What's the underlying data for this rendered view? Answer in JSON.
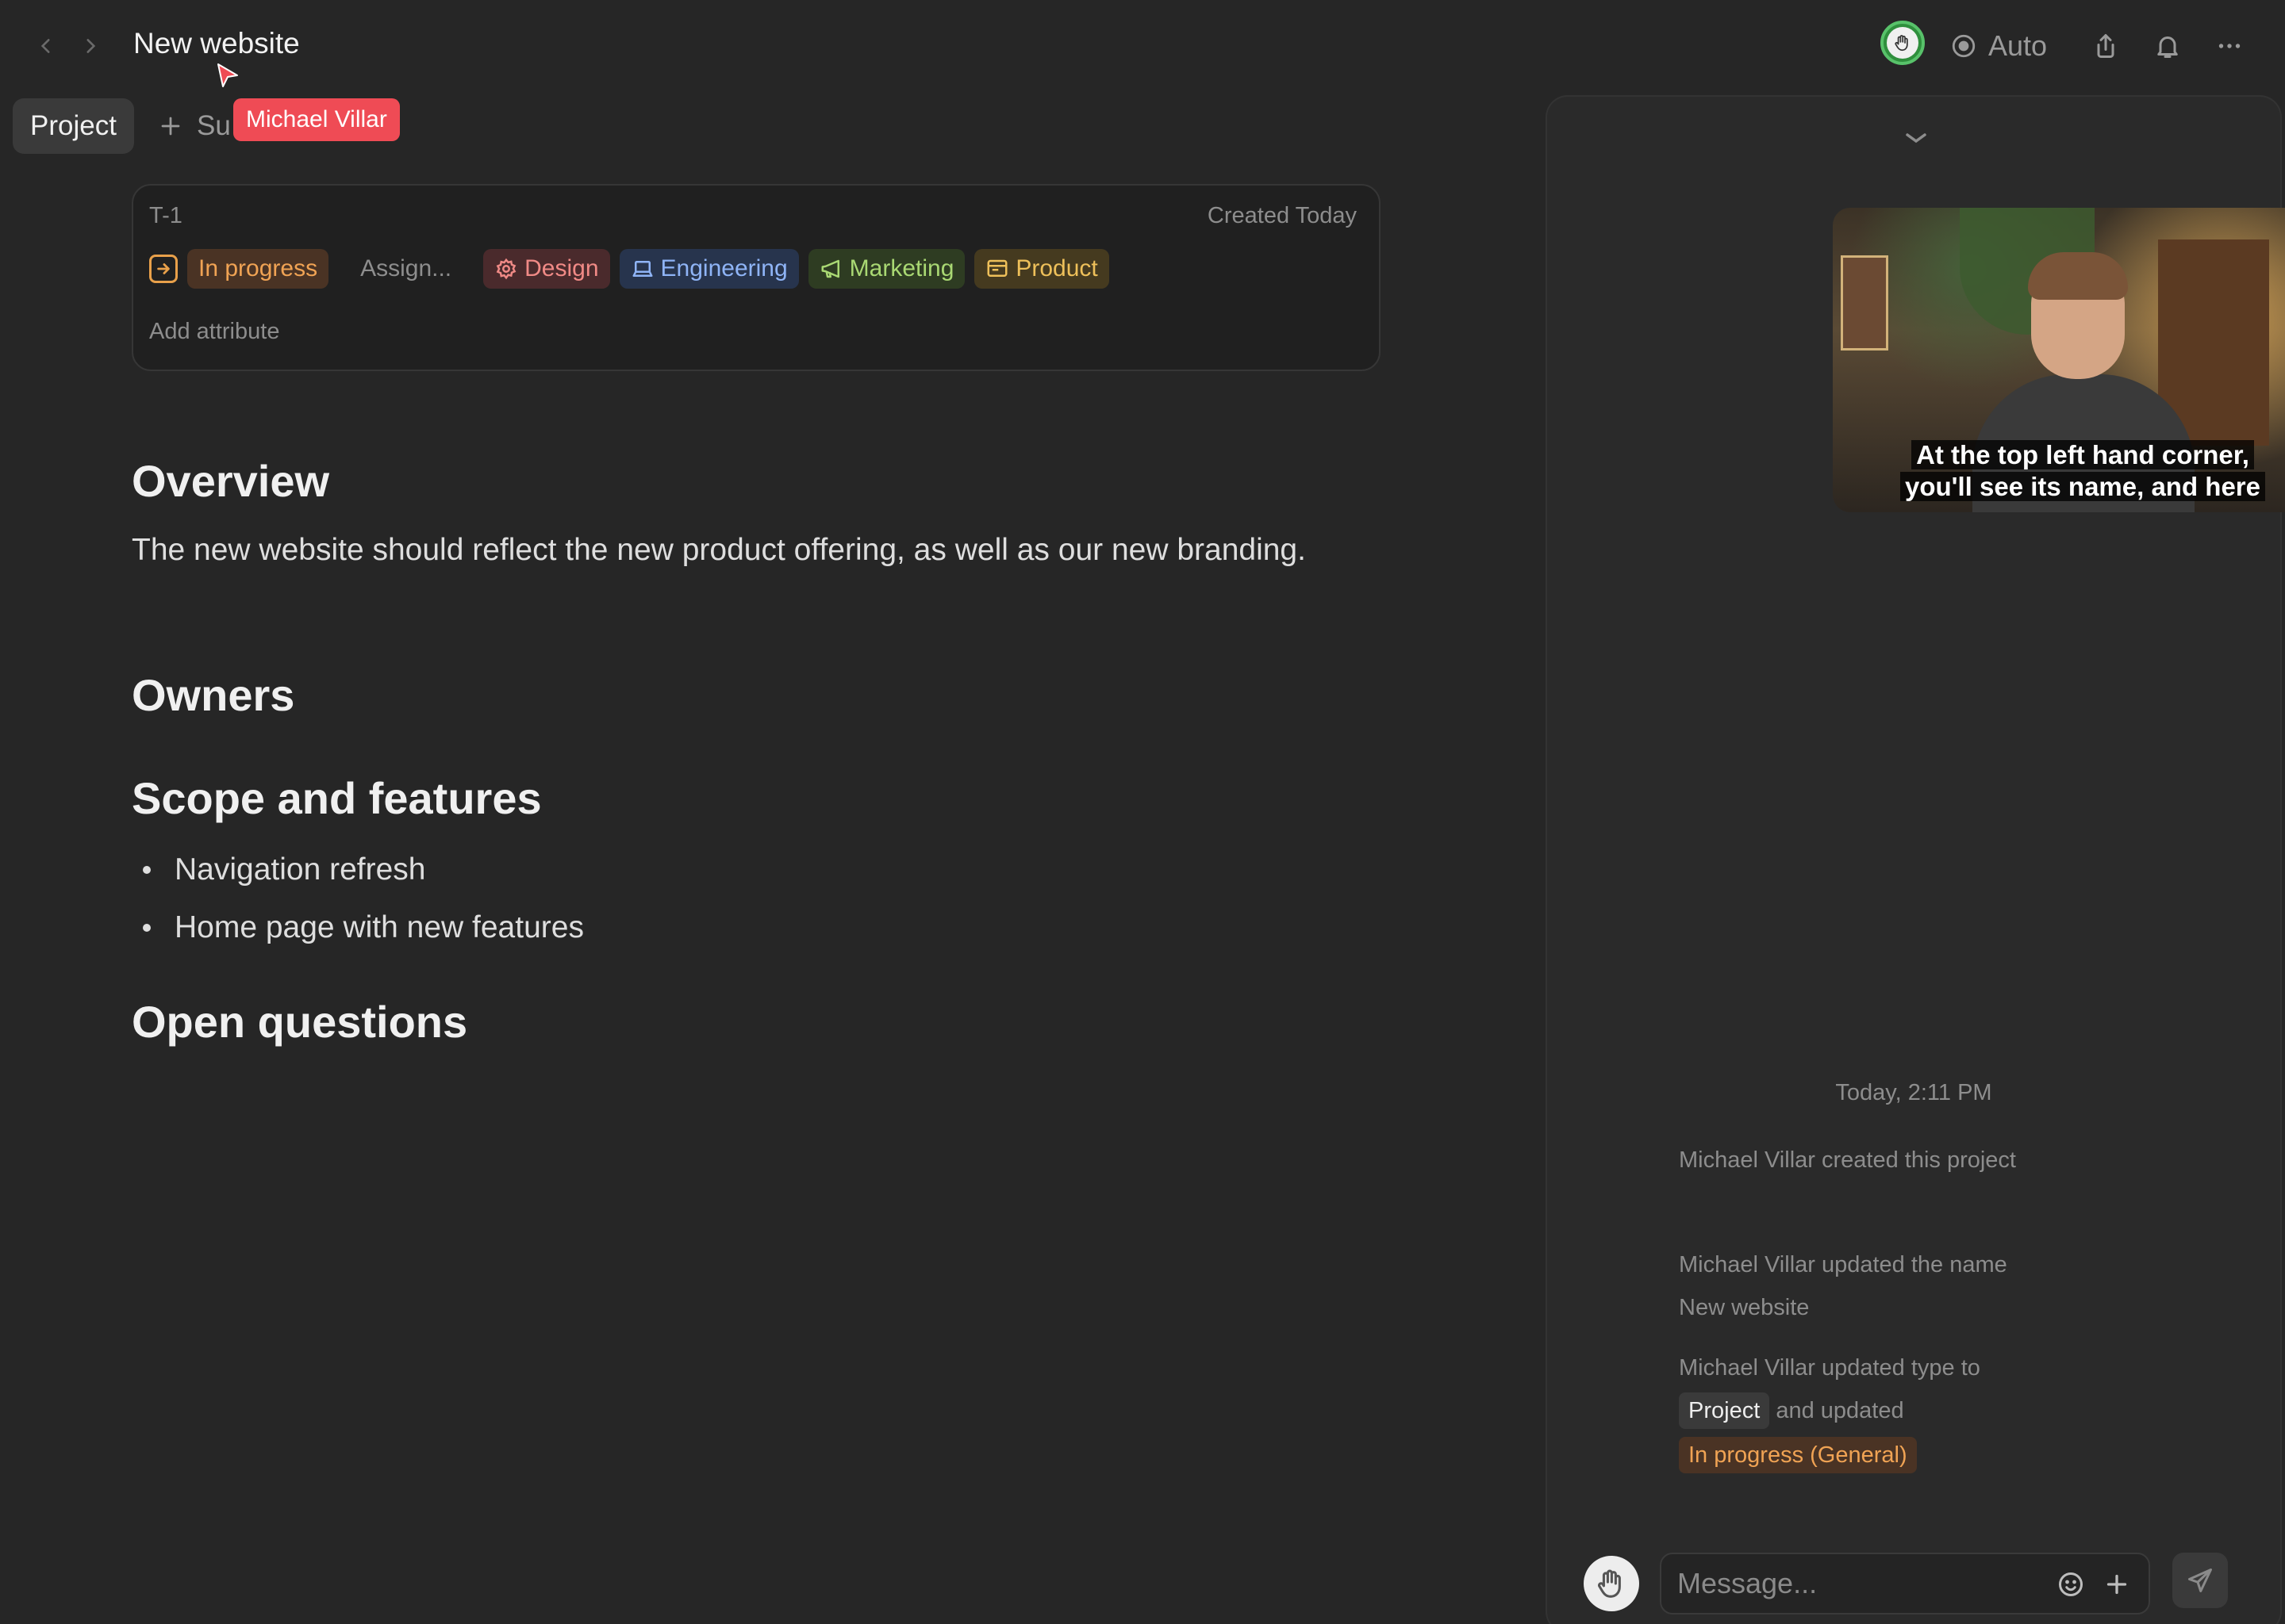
{
  "header": {
    "title": "New website",
    "auto_label": "Auto"
  },
  "tabs": {
    "project_label": "Project",
    "add_sub_label": "Su"
  },
  "cursor": {
    "user": "Michael Villar",
    "color": "#ef4b55"
  },
  "attributes": {
    "id": "T-1",
    "created": "Created Today",
    "status": "In progress",
    "assignee_placeholder": "Assign...",
    "tags": [
      "Design",
      "Engineering",
      "Marketing",
      "Product"
    ],
    "add_attribute": "Add attribute"
  },
  "document": {
    "overview_heading": "Overview",
    "overview_text": "The new website should reflect the new product offering, as well as our new branding.",
    "owners_heading": "Owners",
    "scope_heading": "Scope and features",
    "scope_items": [
      "Navigation refresh",
      "Home page with new features"
    ],
    "open_questions_heading": "Open questions"
  },
  "video": {
    "caption_line1": "At the top left hand corner,",
    "caption_line2": "you'll see its name, and here"
  },
  "activity": {
    "timestamp": "Today, 2:11 PM",
    "entry1": "Michael Villar created this project",
    "entry2_prefix": "Michael Villar updated the name",
    "entry2_value": "New website",
    "entry3_prefix": "Michael Villar updated type to",
    "entry3_chip1": "Project",
    "entry3_mid": "and updated",
    "entry3_chip2": "In progress (General)"
  },
  "composer": {
    "placeholder": "Message..."
  },
  "colors": {
    "background": "#262626",
    "status_orange": "#f0a354",
    "design_red": "#f08a86",
    "engineering_blue": "#8fb4f6",
    "marketing_green": "#a9d873",
    "product_yellow": "#eec05a"
  },
  "icons": [
    "back-arrow-icon",
    "forward-arrow-icon",
    "record-icon",
    "share-icon",
    "bell-icon",
    "more-icon",
    "plus-icon",
    "chevron-down-icon",
    "emoji-icon",
    "send-icon"
  ]
}
